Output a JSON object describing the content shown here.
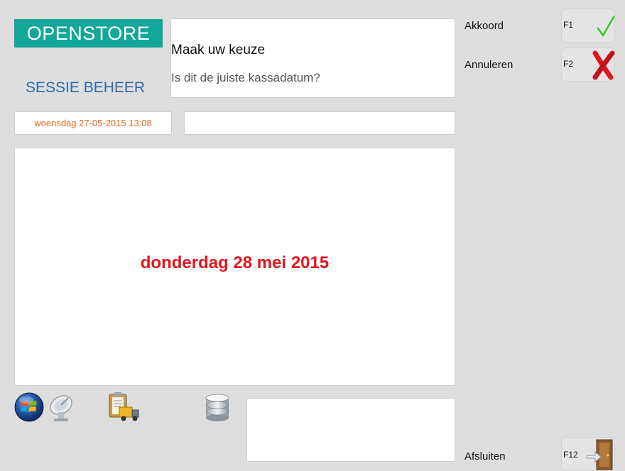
{
  "logo": {
    "text": "OPENSTORE"
  },
  "session": {
    "title": "SESSIE BEHEER"
  },
  "message": {
    "title": "Maak uw keuze",
    "subtitle": "Is dit de juiste kassadatum?"
  },
  "status": {
    "datetime": "woensdag 27-05-2015 13:08",
    "secondary": ""
  },
  "main": {
    "date": "donderdag 28 mei 2015"
  },
  "actions": {
    "accept": {
      "label": "Akkoord",
      "key": "F1",
      "icon": "check-icon"
    },
    "cancel": {
      "label": "Annuleren",
      "key": "F2",
      "icon": "cross-icon"
    },
    "close": {
      "label": "Afsluiten",
      "key": "F12",
      "icon": "exit-door-icon"
    }
  },
  "taskbar_icons": [
    "windows-orb-icon",
    "satellite-dish-icon",
    "clipboard-truck-icon",
    "database-icon"
  ],
  "colors": {
    "background": "#dedede",
    "logo": "#13a79a",
    "session_title": "#2e6aa6",
    "datetime": "#e56a1c",
    "main_date": "#e3161c",
    "check": "#34c924",
    "cross": "#e0141c"
  }
}
